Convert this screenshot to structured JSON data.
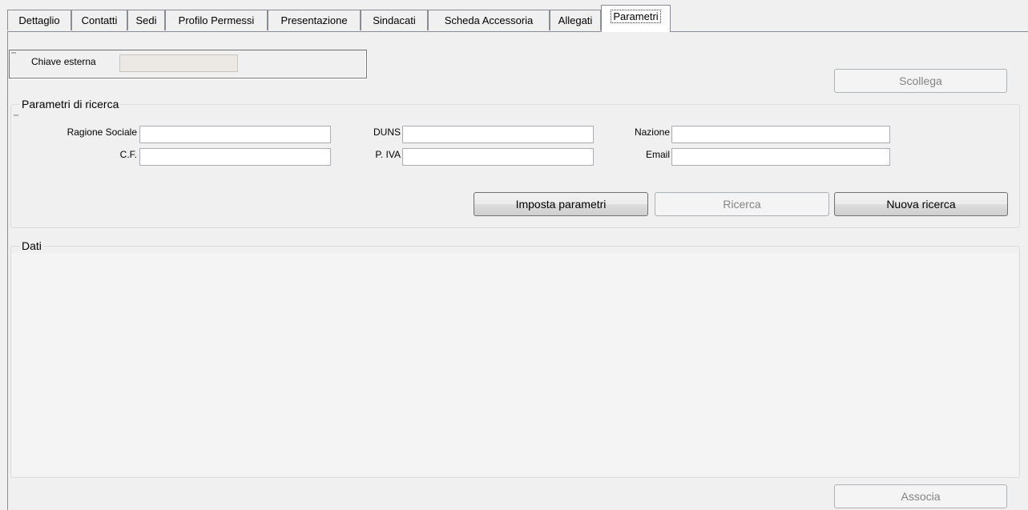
{
  "tabs": [
    "Dettaglio",
    "Contatti",
    "Sedi",
    "Profilo Permessi",
    "Presentazione",
    "Sindacati",
    "Scheda Accessoria",
    "Allegati",
    "Parametri"
  ],
  "active_tab": "Parametri",
  "chiave": {
    "label": "Chiave esterna",
    "value": ""
  },
  "scollega_label": "Scollega",
  "search": {
    "title": "Parametri di ricerca",
    "fields": {
      "ragione_sociale": {
        "label": "Ragione Sociale",
        "value": ""
      },
      "duns": {
        "label": "DUNS",
        "value": ""
      },
      "nazione": {
        "label": "Nazione",
        "value": ""
      },
      "cf": {
        "label": "C.F.",
        "value": ""
      },
      "piva": {
        "label": "P. IVA",
        "value": ""
      },
      "email": {
        "label": "Email",
        "value": ""
      }
    },
    "buttons": {
      "imposta": "Imposta parametri",
      "ricerca": "Ricerca",
      "nuova": "Nuova ricerca"
    }
  },
  "dati": {
    "title": "Dati"
  },
  "associa_label": "Associa"
}
